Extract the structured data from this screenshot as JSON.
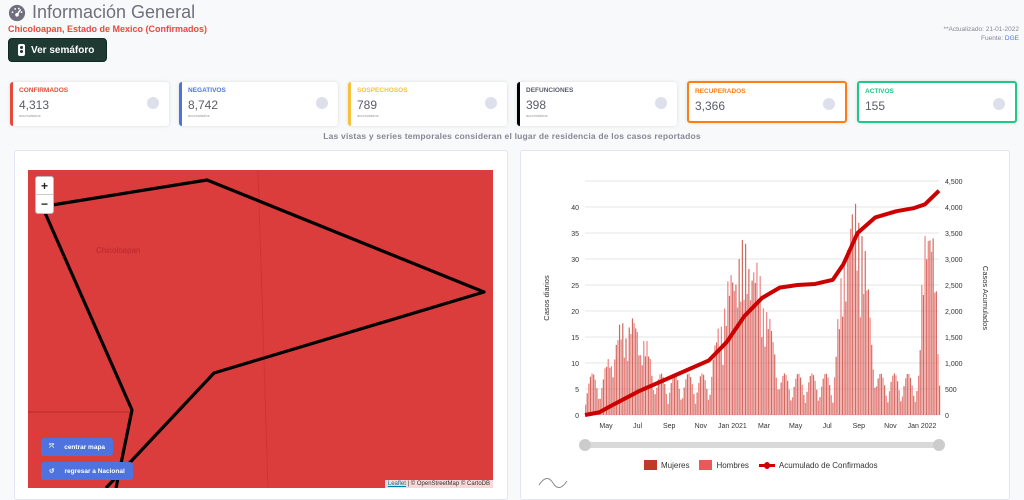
{
  "header": {
    "title": "Información General",
    "subtitle": "Chicoloapan, Estado de Mexico (Confirmados)",
    "semaforo_button": "Ver semáforo",
    "updated": "**Actualizado: 21-01-2022",
    "source_label": "Fuente:",
    "source_link": "DGE"
  },
  "cards": [
    {
      "label": "CONFIRMADOS",
      "value": "4,313",
      "sub": "acumulados",
      "color": "#e74a3b",
      "icon": "plus-circle-icon"
    },
    {
      "label": "NEGATIVOS",
      "value": "8,742",
      "sub": "acumulados",
      "color": "#4e73df",
      "icon": "minus-circle-icon"
    },
    {
      "label": "SOSPECHOSOS",
      "value": "789",
      "sub": "acumulados",
      "color": "#f6c23e",
      "icon": "question-circle-icon"
    },
    {
      "label": "DEFUNCIONES",
      "value": "398",
      "sub": "acumulados",
      "color": "#000000",
      "icon": "ribbon-icon"
    },
    {
      "label": "RECUPERADOS",
      "value": "3,366",
      "sub": "",
      "color": "#fd7e14",
      "icon": "walking-person-icon"
    },
    {
      "label": "ACTIVOS",
      "value": "155",
      "sub": "",
      "color": "#1cc88a",
      "icon": "bed-icon"
    }
  ],
  "note": "Las vistas y series temporales consideran el lugar de residencia de los casos reportados",
  "map": {
    "zoom_in": "+",
    "zoom_out": "−",
    "place_label": "Chicoloapan",
    "center_button": "centrar mapa",
    "back_button": "regresar a Nacional",
    "attribution_leaflet": "Leaflet",
    "attribution_rest": "| © OpenStreetMap © CartoDB",
    "fill_color": "#db3d3d"
  },
  "chart_data": {
    "type": "bar",
    "x_ticks": [
      "May",
      "Jul",
      "Sep",
      "Nov",
      "Jan 2021",
      "Mar",
      "May",
      "Jul",
      "Sep",
      "Nov",
      "Jan 2022"
    ],
    "y_left_label": "Casos diarios",
    "y_left_ticks": [
      0,
      5,
      10,
      15,
      20,
      25,
      30,
      35,
      40
    ],
    "y_left_range": [
      0,
      45
    ],
    "y_right_label": "Casos Acumulados",
    "y_right_ticks": [
      "0",
      "500",
      "1,000",
      "1,500",
      "2,000",
      "2,500",
      "3,000",
      "3,500",
      "4,000",
      "4,500"
    ],
    "y_right_range": [
      0,
      4500
    ],
    "series": [
      {
        "name": "Mujeres",
        "type": "bar",
        "color": "#c0392b"
      },
      {
        "name": "Hombres",
        "type": "bar",
        "color": "#e8595a"
      },
      {
        "name": "Acumulado de Confirmados",
        "type": "line",
        "color": "#cc0000",
        "points": [
          [
            0,
            0
          ],
          [
            0.04,
            50
          ],
          [
            0.08,
            200
          ],
          [
            0.15,
            450
          ],
          [
            0.25,
            750
          ],
          [
            0.35,
            1050
          ],
          [
            0.4,
            1400
          ],
          [
            0.45,
            1900
          ],
          [
            0.5,
            2250
          ],
          [
            0.55,
            2450
          ],
          [
            0.6,
            2500
          ],
          [
            0.65,
            2520
          ],
          [
            0.7,
            2600
          ],
          [
            0.73,
            2900
          ],
          [
            0.77,
            3500
          ],
          [
            0.82,
            3800
          ],
          [
            0.88,
            3920
          ],
          [
            0.93,
            3980
          ],
          [
            0.96,
            4050
          ],
          [
            1.0,
            4313
          ]
        ]
      }
    ]
  }
}
